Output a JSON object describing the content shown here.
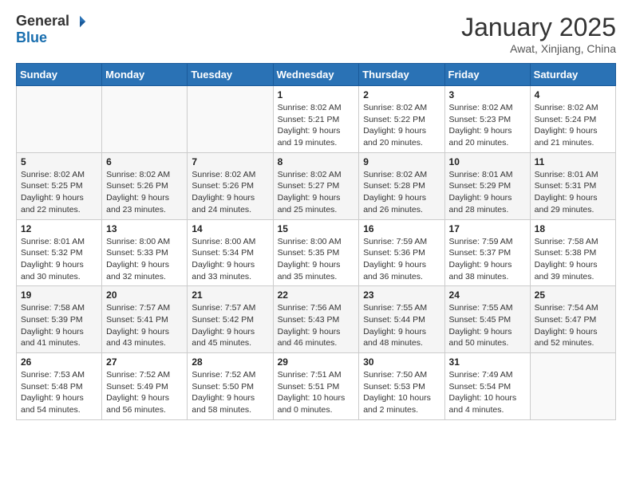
{
  "logo": {
    "general": "General",
    "blue": "Blue"
  },
  "title": "January 2025",
  "location": "Awat, Xinjiang, China",
  "weekdays": [
    "Sunday",
    "Monday",
    "Tuesday",
    "Wednesday",
    "Thursday",
    "Friday",
    "Saturday"
  ],
  "weeks": [
    [
      {
        "day": "",
        "sunrise": "",
        "sunset": "",
        "daylight": ""
      },
      {
        "day": "",
        "sunrise": "",
        "sunset": "",
        "daylight": ""
      },
      {
        "day": "",
        "sunrise": "",
        "sunset": "",
        "daylight": ""
      },
      {
        "day": "1",
        "sunrise": "Sunrise: 8:02 AM",
        "sunset": "Sunset: 5:21 PM",
        "daylight": "Daylight: 9 hours and 19 minutes."
      },
      {
        "day": "2",
        "sunrise": "Sunrise: 8:02 AM",
        "sunset": "Sunset: 5:22 PM",
        "daylight": "Daylight: 9 hours and 20 minutes."
      },
      {
        "day": "3",
        "sunrise": "Sunrise: 8:02 AM",
        "sunset": "Sunset: 5:23 PM",
        "daylight": "Daylight: 9 hours and 20 minutes."
      },
      {
        "day": "4",
        "sunrise": "Sunrise: 8:02 AM",
        "sunset": "Sunset: 5:24 PM",
        "daylight": "Daylight: 9 hours and 21 minutes."
      }
    ],
    [
      {
        "day": "5",
        "sunrise": "Sunrise: 8:02 AM",
        "sunset": "Sunset: 5:25 PM",
        "daylight": "Daylight: 9 hours and 22 minutes."
      },
      {
        "day": "6",
        "sunrise": "Sunrise: 8:02 AM",
        "sunset": "Sunset: 5:26 PM",
        "daylight": "Daylight: 9 hours and 23 minutes."
      },
      {
        "day": "7",
        "sunrise": "Sunrise: 8:02 AM",
        "sunset": "Sunset: 5:26 PM",
        "daylight": "Daylight: 9 hours and 24 minutes."
      },
      {
        "day": "8",
        "sunrise": "Sunrise: 8:02 AM",
        "sunset": "Sunset: 5:27 PM",
        "daylight": "Daylight: 9 hours and 25 minutes."
      },
      {
        "day": "9",
        "sunrise": "Sunrise: 8:02 AM",
        "sunset": "Sunset: 5:28 PM",
        "daylight": "Daylight: 9 hours and 26 minutes."
      },
      {
        "day": "10",
        "sunrise": "Sunrise: 8:01 AM",
        "sunset": "Sunset: 5:29 PM",
        "daylight": "Daylight: 9 hours and 28 minutes."
      },
      {
        "day": "11",
        "sunrise": "Sunrise: 8:01 AM",
        "sunset": "Sunset: 5:31 PM",
        "daylight": "Daylight: 9 hours and 29 minutes."
      }
    ],
    [
      {
        "day": "12",
        "sunrise": "Sunrise: 8:01 AM",
        "sunset": "Sunset: 5:32 PM",
        "daylight": "Daylight: 9 hours and 30 minutes."
      },
      {
        "day": "13",
        "sunrise": "Sunrise: 8:00 AM",
        "sunset": "Sunset: 5:33 PM",
        "daylight": "Daylight: 9 hours and 32 minutes."
      },
      {
        "day": "14",
        "sunrise": "Sunrise: 8:00 AM",
        "sunset": "Sunset: 5:34 PM",
        "daylight": "Daylight: 9 hours and 33 minutes."
      },
      {
        "day": "15",
        "sunrise": "Sunrise: 8:00 AM",
        "sunset": "Sunset: 5:35 PM",
        "daylight": "Daylight: 9 hours and 35 minutes."
      },
      {
        "day": "16",
        "sunrise": "Sunrise: 7:59 AM",
        "sunset": "Sunset: 5:36 PM",
        "daylight": "Daylight: 9 hours and 36 minutes."
      },
      {
        "day": "17",
        "sunrise": "Sunrise: 7:59 AM",
        "sunset": "Sunset: 5:37 PM",
        "daylight": "Daylight: 9 hours and 38 minutes."
      },
      {
        "day": "18",
        "sunrise": "Sunrise: 7:58 AM",
        "sunset": "Sunset: 5:38 PM",
        "daylight": "Daylight: 9 hours and 39 minutes."
      }
    ],
    [
      {
        "day": "19",
        "sunrise": "Sunrise: 7:58 AM",
        "sunset": "Sunset: 5:39 PM",
        "daylight": "Daylight: 9 hours and 41 minutes."
      },
      {
        "day": "20",
        "sunrise": "Sunrise: 7:57 AM",
        "sunset": "Sunset: 5:41 PM",
        "daylight": "Daylight: 9 hours and 43 minutes."
      },
      {
        "day": "21",
        "sunrise": "Sunrise: 7:57 AM",
        "sunset": "Sunset: 5:42 PM",
        "daylight": "Daylight: 9 hours and 45 minutes."
      },
      {
        "day": "22",
        "sunrise": "Sunrise: 7:56 AM",
        "sunset": "Sunset: 5:43 PM",
        "daylight": "Daylight: 9 hours and 46 minutes."
      },
      {
        "day": "23",
        "sunrise": "Sunrise: 7:55 AM",
        "sunset": "Sunset: 5:44 PM",
        "daylight": "Daylight: 9 hours and 48 minutes."
      },
      {
        "day": "24",
        "sunrise": "Sunrise: 7:55 AM",
        "sunset": "Sunset: 5:45 PM",
        "daylight": "Daylight: 9 hours and 50 minutes."
      },
      {
        "day": "25",
        "sunrise": "Sunrise: 7:54 AM",
        "sunset": "Sunset: 5:47 PM",
        "daylight": "Daylight: 9 hours and 52 minutes."
      }
    ],
    [
      {
        "day": "26",
        "sunrise": "Sunrise: 7:53 AM",
        "sunset": "Sunset: 5:48 PM",
        "daylight": "Daylight: 9 hours and 54 minutes."
      },
      {
        "day": "27",
        "sunrise": "Sunrise: 7:52 AM",
        "sunset": "Sunset: 5:49 PM",
        "daylight": "Daylight: 9 hours and 56 minutes."
      },
      {
        "day": "28",
        "sunrise": "Sunrise: 7:52 AM",
        "sunset": "Sunset: 5:50 PM",
        "daylight": "Daylight: 9 hours and 58 minutes."
      },
      {
        "day": "29",
        "sunrise": "Sunrise: 7:51 AM",
        "sunset": "Sunset: 5:51 PM",
        "daylight": "Daylight: 10 hours and 0 minutes."
      },
      {
        "day": "30",
        "sunrise": "Sunrise: 7:50 AM",
        "sunset": "Sunset: 5:53 PM",
        "daylight": "Daylight: 10 hours and 2 minutes."
      },
      {
        "day": "31",
        "sunrise": "Sunrise: 7:49 AM",
        "sunset": "Sunset: 5:54 PM",
        "daylight": "Daylight: 10 hours and 4 minutes."
      },
      {
        "day": "",
        "sunrise": "",
        "sunset": "",
        "daylight": ""
      }
    ]
  ]
}
